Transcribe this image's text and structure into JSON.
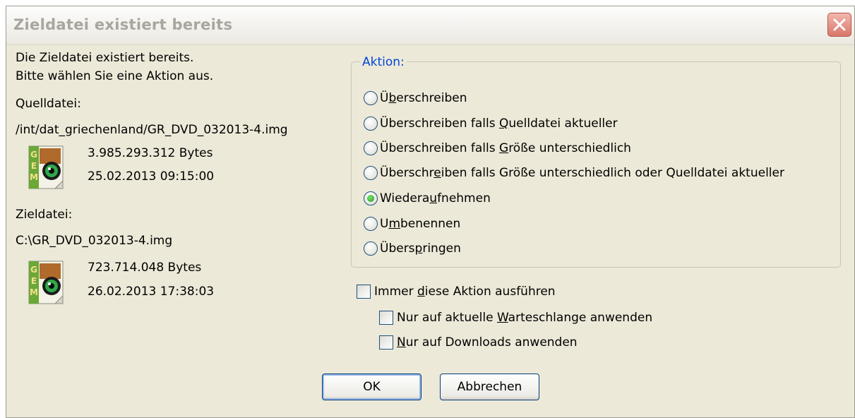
{
  "dialog": {
    "title": "Zieldatei existiert bereits",
    "close_icon": "close-x-icon"
  },
  "message": {
    "line1": "Die Zieldatei existiert bereits.",
    "line2": "Bitte wählen Sie eine Aktion aus."
  },
  "source": {
    "label": "Quelldatei:",
    "path": "/int/dat_griechenland/GR_DVD_032013-4.img",
    "size": "3.985.293.312 Bytes",
    "date": "25.02.2013 09:15:00",
    "icon": "gem-file-icon"
  },
  "target": {
    "label": "Zieldatei:",
    "path": "C:\\GR_DVD_032013-4.img",
    "size": "723.714.048 Bytes",
    "date": "26.02.2013 17:38:03",
    "icon": "gem-file-icon"
  },
  "action_group": {
    "legend": "Aktion:",
    "options": [
      {
        "pre": "Ü",
        "u": "b",
        "post": "erschreiben",
        "selected": false
      },
      {
        "pre": "Überschreiben falls ",
        "u": "Q",
        "post": "uelldatei aktueller",
        "selected": false
      },
      {
        "pre": "Überschreiben falls ",
        "u": "G",
        "post": "röße unterschiedlich",
        "selected": false
      },
      {
        "pre": "Überschr",
        "u": "e",
        "post": "iben falls Größe unterschiedlich oder Quelldatei aktueller",
        "selected": false
      },
      {
        "pre": "Wiedera",
        "u": "u",
        "post": "fnehmen",
        "selected": true
      },
      {
        "pre": "U",
        "u": "m",
        "post": "benennen",
        "selected": false
      },
      {
        "pre": "Übers",
        "u": "p",
        "post": "ringen",
        "selected": false
      }
    ]
  },
  "always": {
    "pre": "Immer ",
    "u": "d",
    "post": "iese Aktion ausführen",
    "checked": false
  },
  "queue_only": {
    "pre": "Nur auf aktuelle ",
    "u": "W",
    "post": "arteschlange anwenden",
    "checked": false
  },
  "downloads_only": {
    "pre": "",
    "u": "N",
    "post": "ur auf Downloads anwenden",
    "checked": false
  },
  "buttons": {
    "ok": "OK",
    "cancel": "Abbrechen"
  },
  "colors": {
    "face": "#ece9d8",
    "legend": "#0046d5",
    "close": "#d9776b"
  }
}
